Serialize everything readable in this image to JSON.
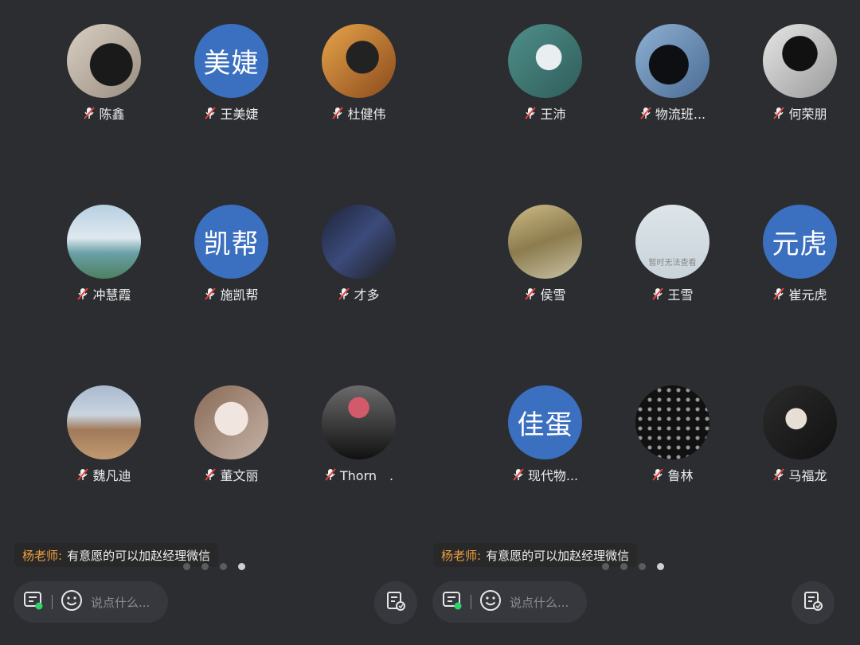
{
  "left": {
    "participants": [
      {
        "name": "陈鑫",
        "avatar": "photo"
      },
      {
        "name": "王美婕",
        "avatar": "text",
        "initials": "美婕"
      },
      {
        "name": "杜健伟",
        "avatar": "photo"
      },
      {
        "name": "冲慧霞",
        "avatar": "photo"
      },
      {
        "name": "施凯帮",
        "avatar": "text",
        "initials": "凯帮"
      },
      {
        "name": "才多",
        "avatar": "photo"
      },
      {
        "name": "魏凡迪",
        "avatar": "photo"
      },
      {
        "name": "董文丽",
        "avatar": "photo"
      },
      {
        "name": "Thorn　.",
        "avatar": "photo"
      }
    ],
    "chat": {
      "sender": "杨老师:",
      "message": "有意愿的可以加赵经理微信"
    },
    "input": {
      "placeholder": "说点什么..."
    }
  },
  "right": {
    "participants": [
      {
        "name": "王沛",
        "avatar": "photo"
      },
      {
        "name": "物流班...",
        "avatar": "photo"
      },
      {
        "name": "何荣朋",
        "avatar": "photo"
      },
      {
        "name": "侯雪",
        "avatar": "photo"
      },
      {
        "name": "王雪",
        "avatar": "photo",
        "caption": "暂时无法查看"
      },
      {
        "name": "崔元虎",
        "avatar": "text",
        "initials": "元虎"
      },
      {
        "name": "现代物...",
        "avatar": "text",
        "initials": "佳蛋"
      },
      {
        "name": "鲁林",
        "avatar": "photo"
      },
      {
        "name": "马福龙",
        "avatar": "photo"
      }
    ],
    "chat": {
      "sender": "杨老师:",
      "message": "有意愿的可以加赵经理微信"
    },
    "input": {
      "placeholder": "说点什么..."
    }
  },
  "colors": {
    "background": "#2b2d31",
    "avatar_text_bg": "#3b6fc0",
    "sender": "#f0a040"
  },
  "icons": {
    "mic_muted": "mic-muted-icon",
    "chat_list": "chat-list-icon",
    "emoji": "emoji-icon",
    "notes": "notes-icon"
  }
}
